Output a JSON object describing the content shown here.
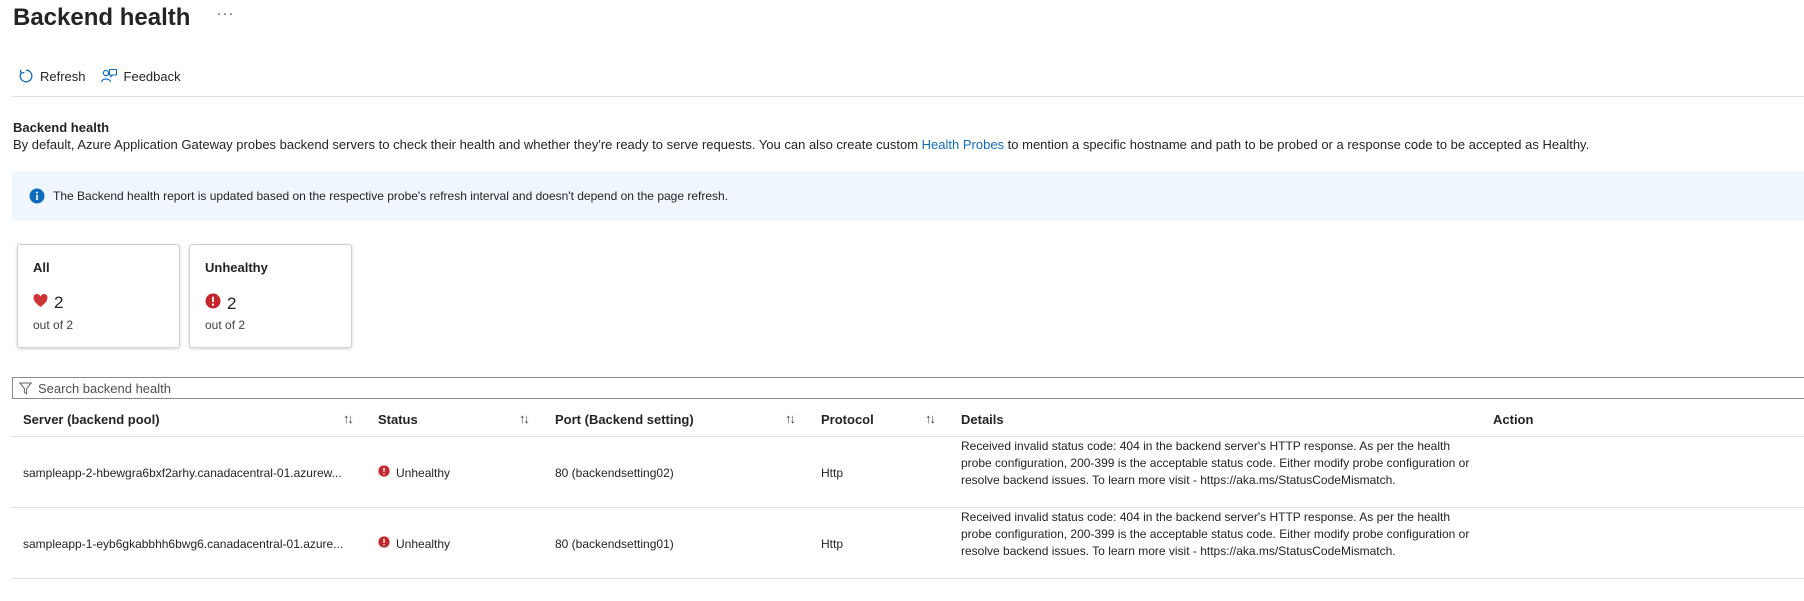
{
  "header": {
    "title": "Backend health",
    "more_label": "···"
  },
  "toolbar": {
    "refresh_label": "Refresh",
    "feedback_label": "Feedback"
  },
  "section": {
    "title": "Backend health",
    "desc_before": "By default, Azure Application Gateway probes backend servers to check their health and whether they're ready to serve requests. You can also create custom ",
    "desc_link": "Health Probes",
    "desc_after": " to mention a specific hostname and path to be probed or a response code to be accepted as Healthy."
  },
  "info": {
    "text": "The Backend health report is updated based on the respective probe's refresh interval and doesn't depend on the page refresh."
  },
  "cards": [
    {
      "title": "All",
      "value": "2",
      "sub": "out of 2",
      "icon": "heart-icon"
    },
    {
      "title": "Unhealthy",
      "value": "2",
      "sub": "out of 2",
      "icon": "error-icon"
    }
  ],
  "search": {
    "placeholder": "Search backend health"
  },
  "table": {
    "columns": [
      "Server (backend pool)",
      "Status",
      "Port (Backend setting)",
      "Protocol",
      "Details",
      "Action"
    ],
    "rows": [
      {
        "server": "sampleapp-2-hbewgra6bxf2arhy.canadacentral-01.azurew...",
        "status": "Unhealthy",
        "port": "80 (backendsetting02)",
        "protocol": "Http",
        "details": "Received invalid status code: 404 in the backend server's HTTP response. As per the health probe configuration, 200-399 is the acceptable status code. Either modify probe configuration or resolve backend issues. To learn more visit - https://aka.ms/StatusCodeMismatch."
      },
      {
        "server": "sampleapp-1-eyb6gkabbhh6bwg6.canadacentral-01.azure...",
        "status": "Unhealthy",
        "port": "80 (backendsetting01)",
        "protocol": "Http",
        "details": "Received invalid status code: 404 in the backend server's HTTP response. As per the health probe configuration, 200-399 is the acceptable status code. Either modify probe configuration or resolve backend issues. To learn more visit - https://aka.ms/StatusCodeMismatch."
      }
    ]
  },
  "colors": {
    "link": "#0f6cbd",
    "info_bg": "#eff6fc",
    "error": "#c4262e",
    "heart": "#d13438"
  }
}
